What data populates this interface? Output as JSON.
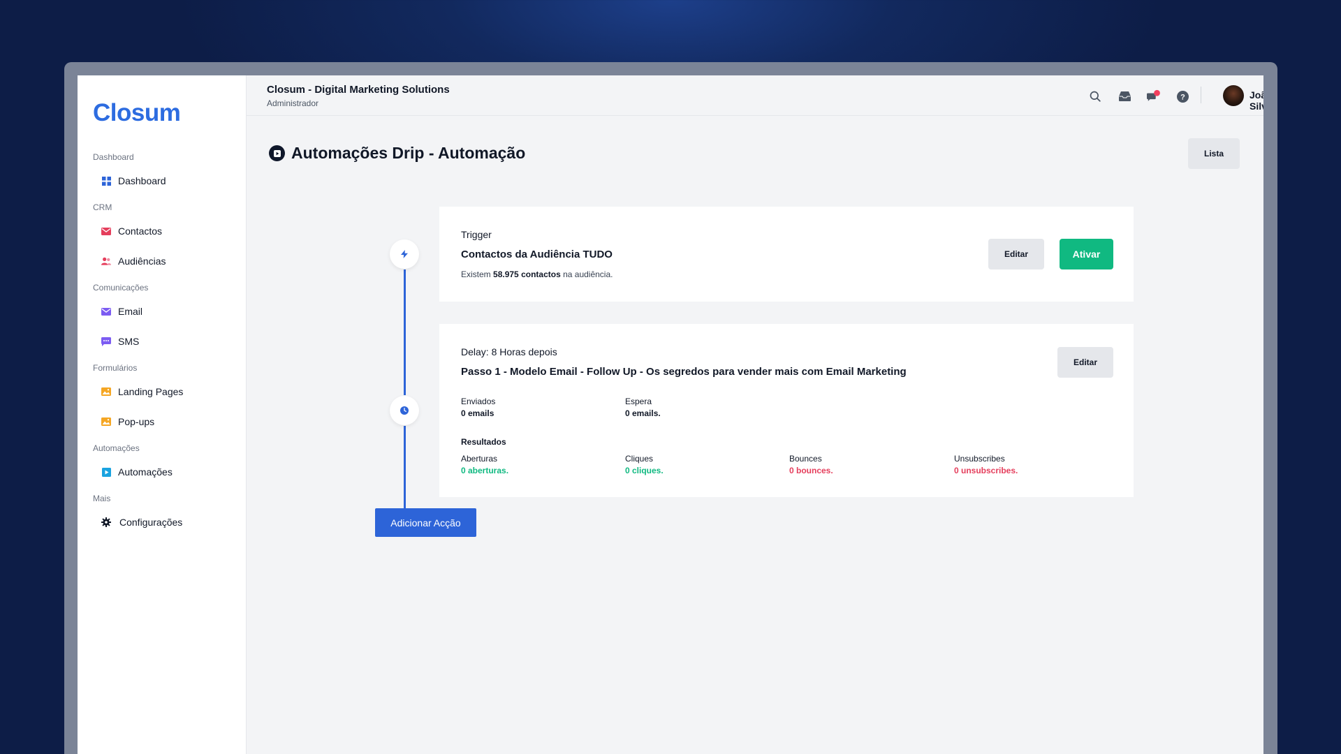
{
  "app": {
    "logo_text": "Closum",
    "company": "Closum - Digital Marketing Solutions",
    "role": "Administrador"
  },
  "user": {
    "name": "João Silva"
  },
  "sidebar": {
    "sections": [
      {
        "label": "Dashboard",
        "items": [
          {
            "label": "Dashboard",
            "icon": "grid-icon",
            "color": "#2d64d8"
          }
        ]
      },
      {
        "label": "CRM",
        "items": [
          {
            "label": "Contactos",
            "icon": "envelope-icon",
            "color": "#e53e5c"
          },
          {
            "label": "Audiências",
            "icon": "users-icon",
            "color": "#e53e5c"
          }
        ]
      },
      {
        "label": "Comunicações",
        "items": [
          {
            "label": "Email",
            "icon": "mail-icon",
            "color": "#7c5cf2"
          },
          {
            "label": "SMS",
            "icon": "chat-icon",
            "color": "#7c5cf2"
          }
        ]
      },
      {
        "label": "Formulários",
        "items": [
          {
            "label": "Landing Pages",
            "icon": "image-icon",
            "color": "#f5a623"
          },
          {
            "label": "Pop-ups",
            "icon": "image-icon",
            "color": "#f5a623"
          }
        ]
      },
      {
        "label": "Automações",
        "items": [
          {
            "label": "Automações",
            "icon": "play-square-icon",
            "color": "#1aa3e0"
          }
        ]
      },
      {
        "label": "Mais",
        "items": [
          {
            "label": "Configurações",
            "icon": "gear-icon",
            "color": "#111827"
          }
        ]
      }
    ]
  },
  "page": {
    "title": "Automações Drip - Automação",
    "list_button": "Lista",
    "add_action_button": "Adicionar Acção"
  },
  "trigger": {
    "label": "Trigger",
    "heading": "Contactos da Audiência TUDO",
    "desc_prefix": "Existem",
    "desc_bold": "58.975 contactos",
    "desc_suffix": "na audiência.",
    "edit_button": "Editar",
    "activate_button": "Ativar"
  },
  "step": {
    "label": "Delay: 8 Horas depois",
    "heading": "Passo 1 - Modelo Email - Follow Up - Os segredos para vender mais com Email Marketing",
    "edit_button": "Editar",
    "stats": [
      {
        "label": "Enviados",
        "value": "0 emails"
      },
      {
        "label": "Espera",
        "value": "0 emails."
      }
    ],
    "results_label": "Resultados",
    "results": [
      {
        "label": "Aberturas",
        "value": "0 aberturas.",
        "tone": "green"
      },
      {
        "label": "Cliques",
        "value": "0 cliques.",
        "tone": "green"
      },
      {
        "label": "Bounces",
        "value": "0 bounces.",
        "tone": "red"
      },
      {
        "label": "Unsubscribes",
        "value": "0 unsubscribes.",
        "tone": "red"
      }
    ]
  },
  "colors": {
    "brand": "#2d6ce0",
    "primary": "#2d64d8",
    "success": "#10b981",
    "danger": "#e53e5c",
    "notification_dot": "#f43f5e"
  }
}
